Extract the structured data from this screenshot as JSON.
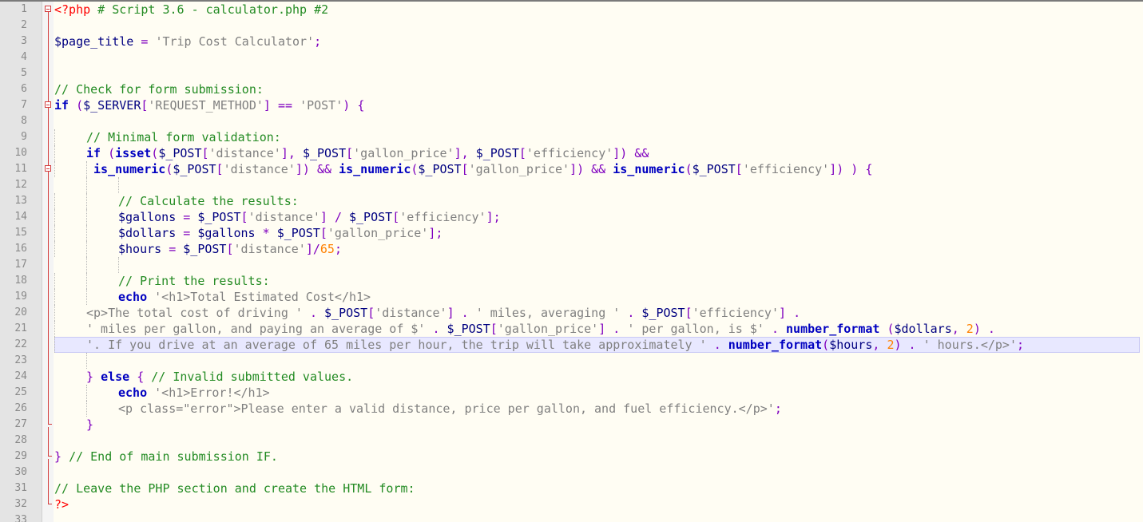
{
  "editor": {
    "language": "php",
    "active_line": 22,
    "lines": [
      {
        "n": "1"
      },
      {
        "n": "2"
      },
      {
        "n": "3"
      },
      {
        "n": "4"
      },
      {
        "n": "5"
      },
      {
        "n": "6"
      },
      {
        "n": "7"
      },
      {
        "n": "8"
      },
      {
        "n": "9"
      },
      {
        "n": "10"
      },
      {
        "n": "11"
      },
      {
        "n": "12"
      },
      {
        "n": "13"
      },
      {
        "n": "14"
      },
      {
        "n": "15"
      },
      {
        "n": "16"
      },
      {
        "n": "17"
      },
      {
        "n": "18"
      },
      {
        "n": "19"
      },
      {
        "n": "20"
      },
      {
        "n": "21"
      },
      {
        "n": "22"
      },
      {
        "n": "23"
      },
      {
        "n": "24"
      },
      {
        "n": "25"
      },
      {
        "n": "26"
      },
      {
        "n": "27"
      },
      {
        "n": "28"
      },
      {
        "n": "29"
      },
      {
        "n": "30"
      },
      {
        "n": "31"
      },
      {
        "n": "32"
      },
      {
        "n": "33"
      }
    ],
    "code": {
      "l1": [
        "<?php",
        " # Script 3.6 - calculator.php #2"
      ],
      "l3": [
        "$page_title",
        " ",
        "=",
        " ",
        "'Trip Cost Calculator'",
        ";"
      ],
      "l6": [
        "// Check for form submission:"
      ],
      "l7": [
        "if",
        " ",
        "(",
        "$_SERVER",
        "[",
        "'REQUEST_METHOD'",
        "]",
        " ",
        "==",
        " ",
        "'POST'",
        ")",
        " ",
        "{"
      ],
      "l9": [
        "// Minimal form validation:"
      ],
      "l10": [
        "if",
        " ",
        "(",
        "isset",
        "(",
        "$_POST",
        "[",
        "'distance'",
        "],",
        " ",
        "$_POST",
        "[",
        "'gallon_price'",
        "],",
        " ",
        "$_POST",
        "[",
        "'efficiency'",
        "])",
        " ",
        "&&"
      ],
      "l11": [
        "is_numeric",
        "(",
        "$_POST",
        "[",
        "'distance'",
        "])",
        " ",
        "&&",
        " ",
        "is_numeric",
        "(",
        "$_POST",
        "[",
        "'gallon_price'",
        "])",
        " ",
        "&&",
        " ",
        "is_numeric",
        "(",
        "$_POST",
        "[",
        "'efficiency'",
        "])",
        " ",
        ")",
        " ",
        "{"
      ],
      "l13": [
        "// Calculate the results:"
      ],
      "l14": [
        "$gallons",
        " ",
        "=",
        " ",
        "$_POST",
        "[",
        "'distance'",
        "]",
        " ",
        "/",
        " ",
        "$_POST",
        "[",
        "'efficiency'",
        "];"
      ],
      "l15": [
        "$dollars",
        " ",
        "=",
        " ",
        "$gallons",
        " ",
        "*",
        " ",
        "$_POST",
        "[",
        "'gallon_price'",
        "];"
      ],
      "l16": [
        "$hours",
        " ",
        "=",
        " ",
        "$_POST",
        "[",
        "'distance'",
        "]/",
        "65",
        ";"
      ],
      "l18": [
        "// Print the results:"
      ],
      "l19": [
        "echo",
        " ",
        "'<h1>Total Estimated Cost</h1>"
      ],
      "l20": [
        "<p>The total cost of driving '",
        " ",
        ".",
        " ",
        "$_POST",
        "[",
        "'distance'",
        "]",
        " ",
        ".",
        " ",
        "' miles, averaging '",
        " ",
        ".",
        " ",
        "$_POST",
        "[",
        "'efficiency'",
        "]",
        " ",
        "."
      ],
      "l21": [
        "' miles per gallon, and paying an average of $'",
        " ",
        ".",
        " ",
        "$_POST",
        "[",
        "'gallon_price'",
        "]",
        " ",
        ".",
        " ",
        "' per gallon, is $'",
        " ",
        ".",
        " ",
        "number_format",
        " ",
        "(",
        "$dollars",
        ",",
        " ",
        "2",
        ")",
        " ",
        "."
      ],
      "l22": [
        "'. If you drive at an average of 65 miles per hour, the trip will take approximately '",
        " ",
        ".",
        " ",
        "number_format",
        "(",
        "$hours",
        ",",
        " ",
        "2",
        ")",
        " ",
        ".",
        " ",
        "' hours.</p>'",
        ";"
      ],
      "l24": [
        "}",
        " ",
        "else",
        " ",
        "{",
        " ",
        "// Invalid submitted values."
      ],
      "l25": [
        "echo",
        " ",
        "'<h1>Error!</h1>"
      ],
      "l26": [
        "<p class=\"error\">Please enter a valid distance, price per gallon, and fuel efficiency.</p>'",
        ";"
      ],
      "l27": [
        "}"
      ],
      "l29": [
        "}",
        " ",
        "// End of main submission IF."
      ],
      "l31": [
        "// Leave the PHP section and create the HTML form:"
      ],
      "l32": [
        "?>"
      ]
    }
  },
  "colors": {
    "keyword": "#0000c0",
    "comment": "#238b23",
    "string": "#808080",
    "punctuation": "#7f00bf",
    "number": "#ff8000",
    "php_tag": "#ff0000",
    "variable": "#000080",
    "fold_marker": "#d43c3c",
    "active_line_bg": "#e8e8ff",
    "editor_bg": "#fffdf3",
    "gutter_bg": "#e4e4e4"
  }
}
